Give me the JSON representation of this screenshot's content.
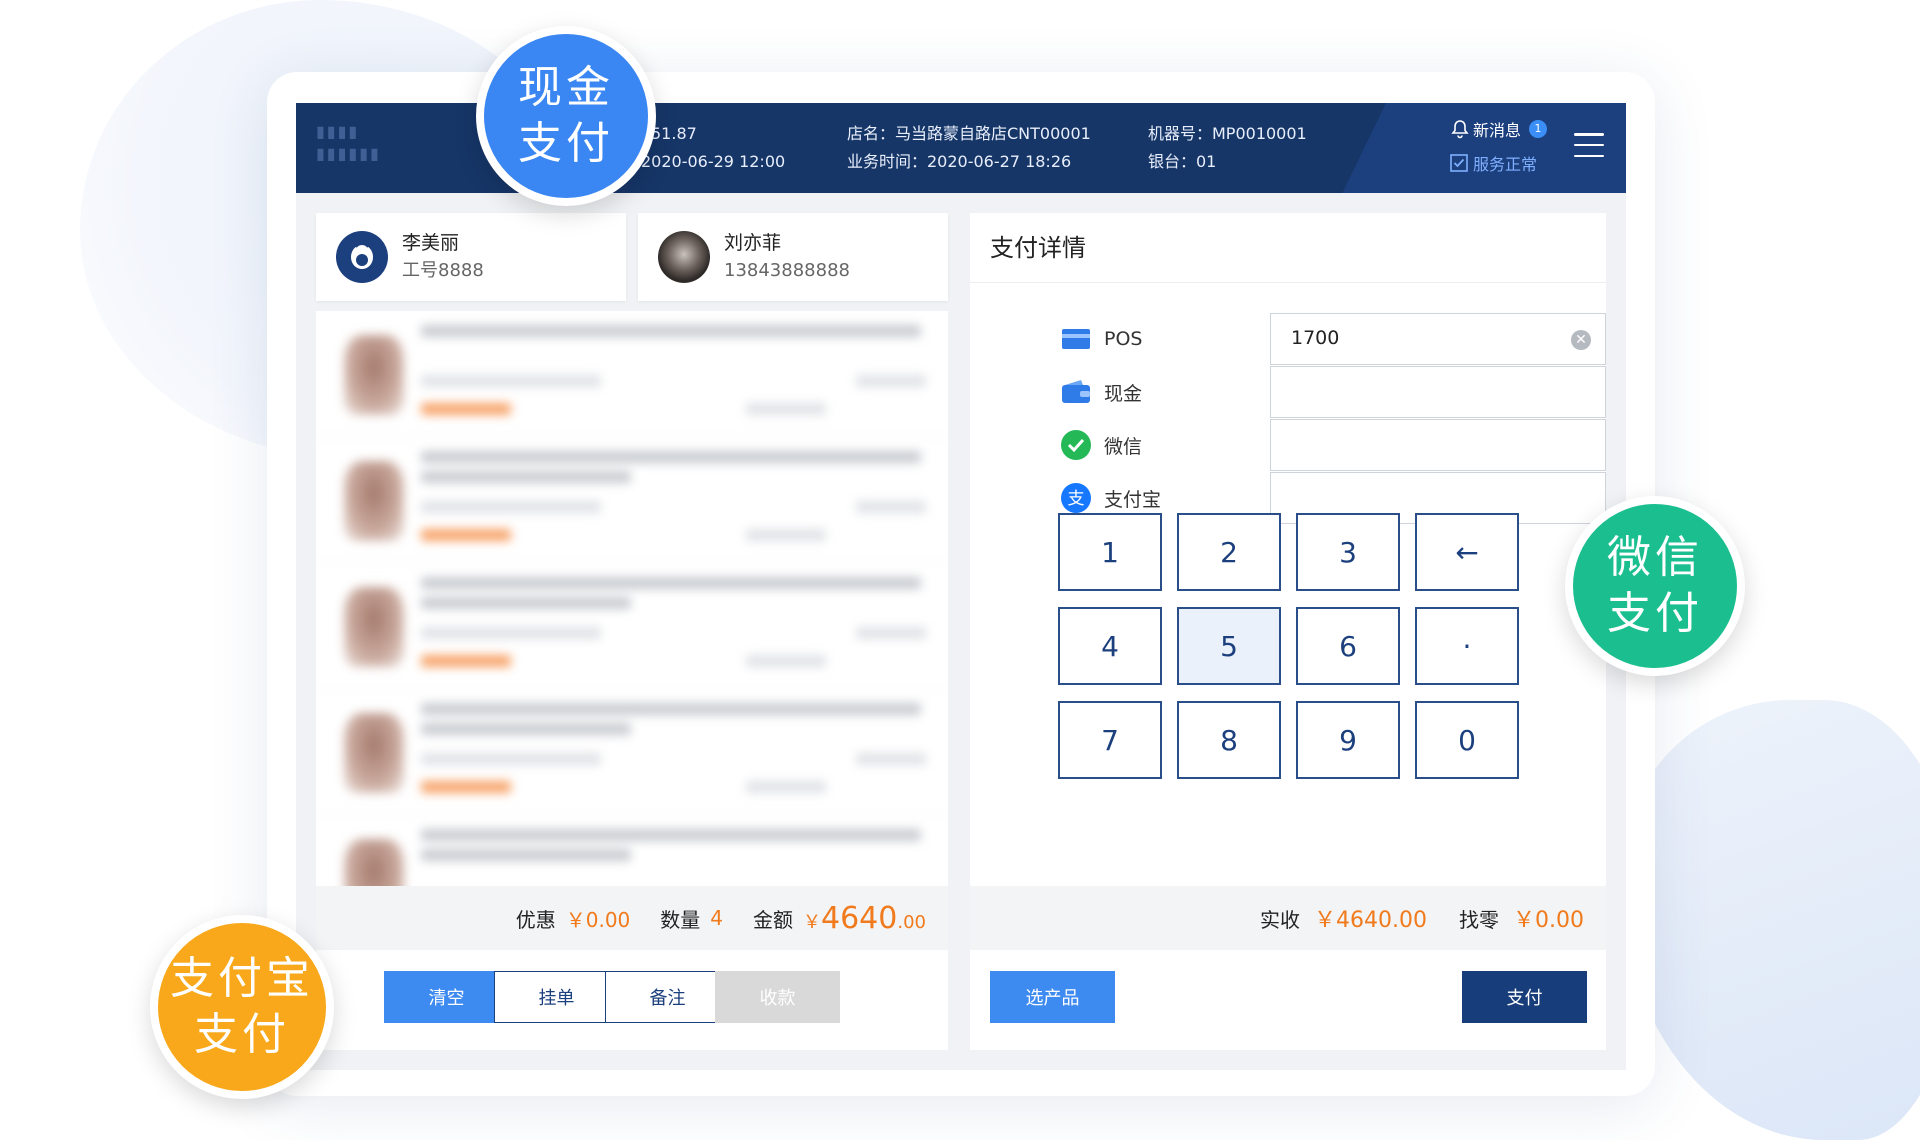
{
  "header": {
    "partial_value": "51.87",
    "datetime_left": "2020-06-29 12:00",
    "store_name": "店名：马当路蒙自路店CNT00001",
    "business_time": "业务时间：2020-06-27 18:26",
    "machine_no": "机器号：MP0010001",
    "cashier": "银台：01",
    "new_msg_label": "新消息",
    "new_msg_count": "1",
    "service_status": "服务正常"
  },
  "staff": {
    "name": "李美丽",
    "id": "工号8888"
  },
  "customer": {
    "name": "刘亦菲",
    "phone": "13843888888"
  },
  "order_summary": {
    "discount_label": "优惠",
    "discount_value": "￥0.00",
    "qty_label": "数量",
    "qty_value": "4",
    "amount_label": "金额",
    "amount_currency": "￥",
    "amount_int": "4640",
    "amount_dec": ".00"
  },
  "left_buttons": {
    "clear": "清空",
    "hold": "挂单",
    "note": "备注",
    "collect": "收款"
  },
  "payment": {
    "title": "支付详情",
    "methods": [
      {
        "label": "POS",
        "value": "1700",
        "icon": "card-icon"
      },
      {
        "label": "现金",
        "value": "",
        "icon": "wallet-icon"
      },
      {
        "label": "微信",
        "value": "",
        "icon": "wechat-icon"
      },
      {
        "label": "支付宝",
        "value": "",
        "icon": "alipay-icon"
      }
    ],
    "keypad": [
      "1",
      "2",
      "3",
      "←",
      "4",
      "5",
      "6",
      "·",
      "7",
      "8",
      "9",
      "0"
    ],
    "received_label": "实收",
    "received_value": "￥4640.00",
    "change_label": "找零",
    "change_value": "￥0.00",
    "select_product": "选产品",
    "pay": "支付"
  },
  "bubbles": {
    "cash": [
      "现金",
      "支付"
    ],
    "wechat": [
      "微信",
      "支付"
    ],
    "alipay": [
      "支付宝",
      "支付"
    ]
  },
  "colors": {
    "navy": "#1c3f7e",
    "accent_blue": "#3d8af0",
    "orange": "#f07a1c",
    "wechat_green": "#1bbf8f",
    "alipay_orange": "#f8a81a"
  }
}
